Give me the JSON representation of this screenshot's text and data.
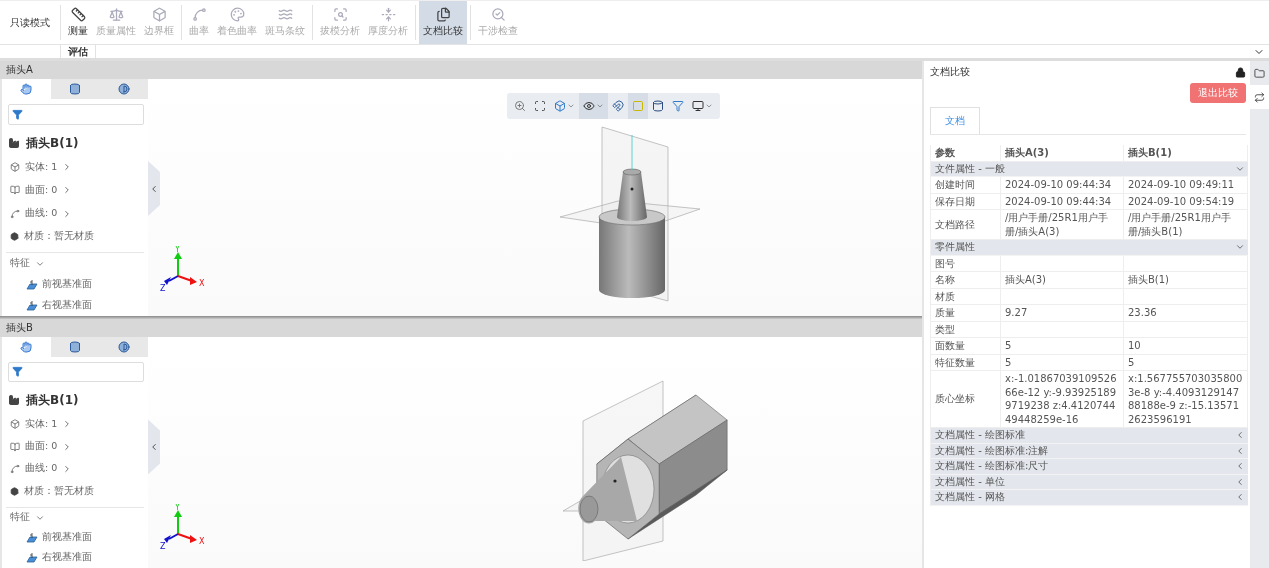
{
  "toolbar": {
    "mode": "只读模式",
    "groups": [
      [
        {
          "label": "测量",
          "disabled": false,
          "selected": false
        },
        {
          "label": "质量属性",
          "disabled": true,
          "selected": false
        },
        {
          "label": "边界框",
          "disabled": true,
          "selected": false
        }
      ],
      [
        {
          "label": "曲率",
          "disabled": true,
          "selected": false
        },
        {
          "label": "着色曲率",
          "disabled": true,
          "selected": false
        },
        {
          "label": "斑马条纹",
          "disabled": true,
          "selected": false
        }
      ],
      [
        {
          "label": "拔模分析",
          "disabled": true,
          "selected": false
        },
        {
          "label": "厚度分析",
          "disabled": true,
          "selected": false
        }
      ],
      [
        {
          "label": "文档比较",
          "disabled": false,
          "selected": true
        }
      ],
      [
        {
          "label": "干涉检查",
          "disabled": true,
          "selected": false
        }
      ]
    ],
    "ribbon_tabs": [
      {
        "label": "评估",
        "selected": true
      }
    ]
  },
  "viewports": [
    {
      "title": "插头A",
      "kind": "cylinder",
      "panel_tabs": [
        {
          "selected": true
        },
        {
          "selected": false
        },
        {
          "selected": false
        }
      ],
      "part": "插头B(1)",
      "counts": [
        "实体: 1",
        "曲面: 0",
        "曲线: 0"
      ],
      "material": "材质：暂无材质",
      "features_label": "特征",
      "features_expanded": true,
      "features": [
        "前视基准面",
        "右视基准面"
      ],
      "view_tools": [
        {
          "selected": false,
          "menu": false
        },
        {
          "selected": false,
          "menu": false
        },
        {
          "selected": false,
          "menu": true
        },
        {
          "selected": true,
          "menu": true
        },
        {
          "selected": false,
          "menu": false
        },
        {
          "selected": true,
          "menu": false
        },
        {
          "selected": false,
          "menu": false
        },
        {
          "selected": false,
          "menu": false
        },
        {
          "selected": false,
          "menu": true
        }
      ],
      "axes": [
        "X",
        "Y",
        "Z"
      ]
    },
    {
      "title": "插头B",
      "kind": "hexagon",
      "panel_tabs": [
        {
          "selected": true
        },
        {
          "selected": false
        },
        {
          "selected": false
        }
      ],
      "part": "插头B(1)",
      "counts": [
        "实体: 1",
        "曲面: 0",
        "曲线: 0"
      ],
      "material": "材质：暂无材质",
      "features_label": "特征",
      "features_expanded": true,
      "features": [
        "前视基准面",
        "右视基准面"
      ],
      "axes": [
        "X",
        "Y",
        "Z"
      ]
    }
  ],
  "compare": {
    "title": "文档比较",
    "exit_button": "退出比较",
    "tabs": [
      {
        "label": "文档",
        "selected": true
      }
    ],
    "columns": [
      "参数",
      "插头A(3)",
      "插头B(1)"
    ],
    "sections": [
      {
        "title": "文件属性 - 一般",
        "expanded": true,
        "rows": [
          {
            "cells": [
              "创建时间",
              "2024-09-10 09:44:34",
              "2024-09-10 09:49:11"
            ]
          },
          {
            "cells": [
              "保存日期",
              "2024-09-10 09:44:34",
              "2024-09-10 09:54:19"
            ]
          },
          {
            "cells": [
              "文档路径",
              "/用户手册/25R1用户手册/插头A(3)",
              "/用户手册/25R1用户手册/插头B(1)"
            ]
          }
        ]
      },
      {
        "title": "零件属性",
        "expanded": true,
        "rows": [
          {
            "cells": [
              "图号"
            ]
          },
          {
            "cells": [
              "名称",
              "插头A(3)",
              "插头B(1)"
            ]
          },
          {
            "cells": [
              "材质"
            ]
          },
          {
            "cells": [
              "质量",
              "9.27",
              "23.36"
            ]
          },
          {
            "cells": [
              "类型"
            ]
          },
          {
            "cells": [
              "面数量",
              "5",
              "10"
            ]
          },
          {
            "cells": [
              "特征数量",
              "5",
              "5"
            ]
          },
          {
            "cells": [
              "质心坐标",
              "x:-1.0186703910952666e-12 y:-9.939251899719238 z:4.412074449448259e-16",
              "x:1.5677557030358003e-8 y:-4.409312914788188e-9 z:-15.135712623596191"
            ]
          }
        ]
      },
      {
        "title": "文档属性 - 绘图标准",
        "expanded": false
      },
      {
        "title": "文档属性 - 绘图标准:注解",
        "expanded": false
      },
      {
        "title": "文档属性 - 绘图标准:尺寸",
        "expanded": false
      },
      {
        "title": "文档属性 - 单位",
        "expanded": false
      },
      {
        "title": "文档属性 - 网格",
        "expanded": false
      }
    ]
  },
  "side_tabs": [
    {
      "selected": false
    },
    {
      "selected": true
    }
  ]
}
